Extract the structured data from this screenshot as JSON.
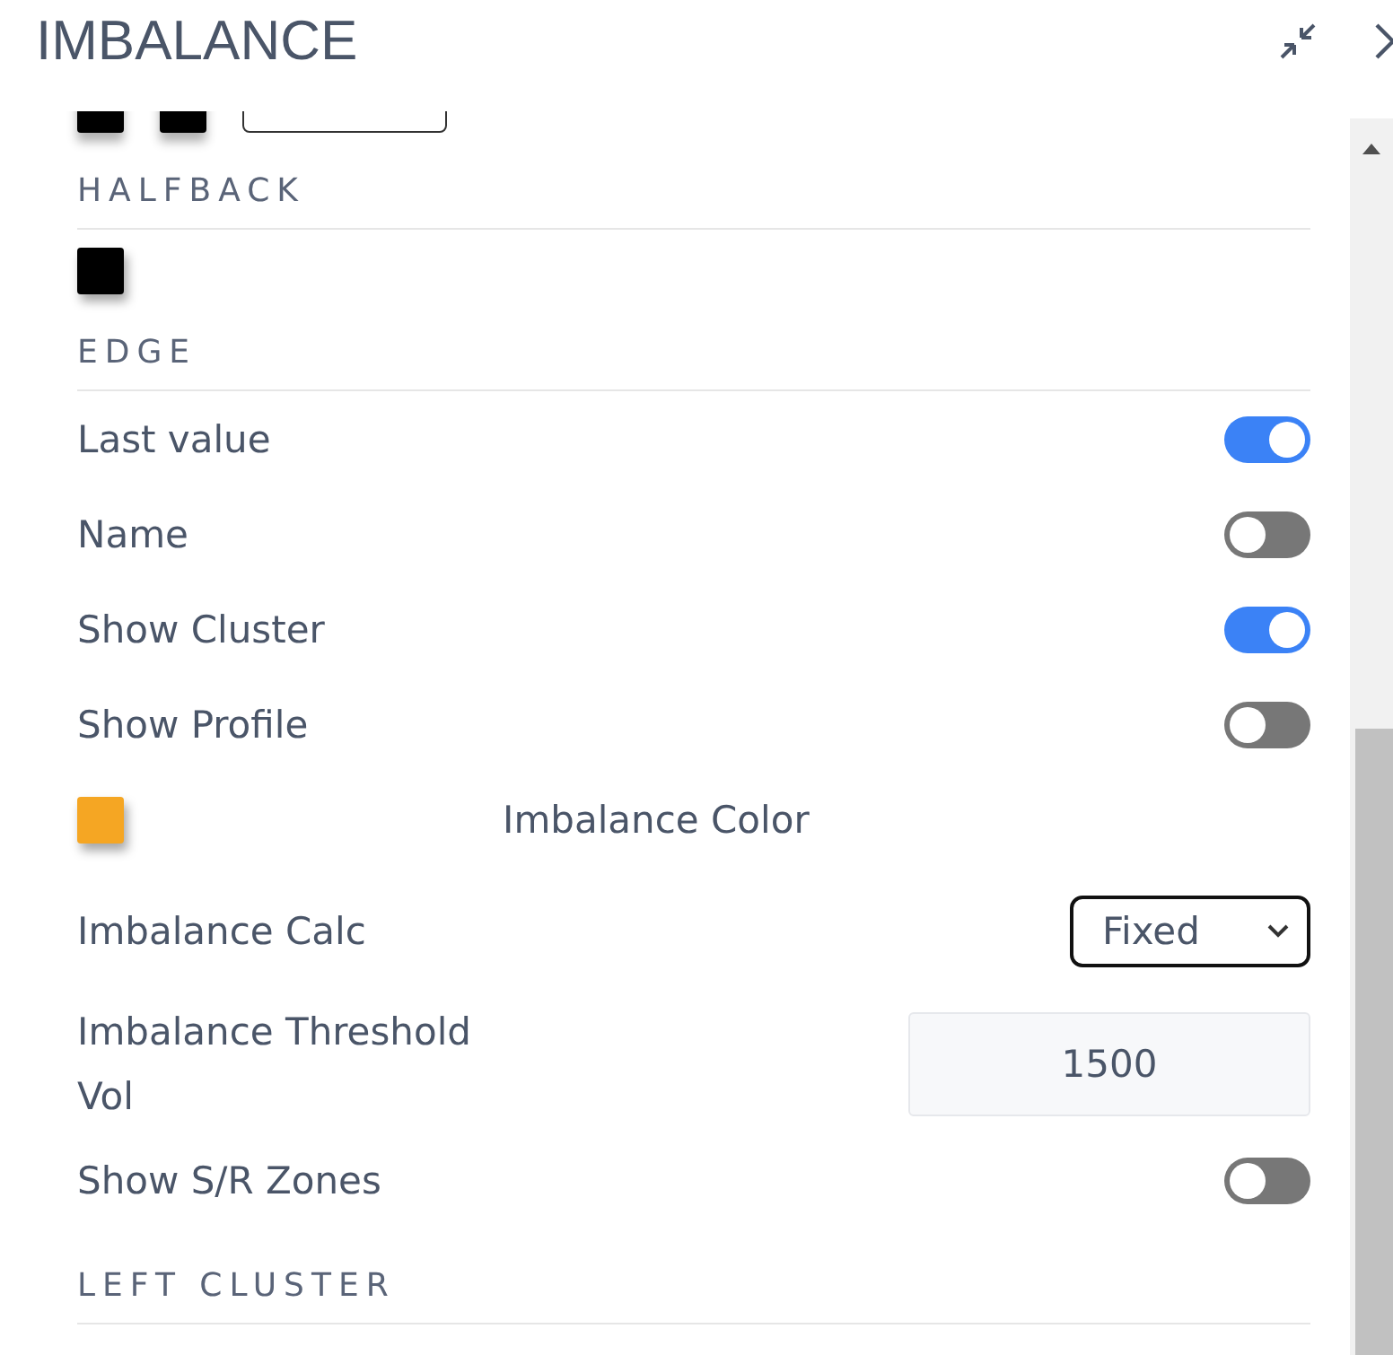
{
  "window": {
    "title": "IMBALANCE"
  },
  "top_swatches": [
    {
      "color": "#000000"
    },
    {
      "color": "#000000"
    }
  ],
  "rows": [
    {
      "kind": "section",
      "label": "HALFBACK"
    },
    {
      "kind": "swatch",
      "color": "#000000"
    },
    {
      "kind": "section",
      "label": "EDGE"
    },
    {
      "kind": "toggle",
      "label": "Last value",
      "on": true
    },
    {
      "kind": "toggle",
      "label": "Name",
      "on": false
    },
    {
      "kind": "toggle",
      "label": "Show Cluster",
      "on": true
    },
    {
      "kind": "toggle",
      "label": "Show Profile",
      "on": false
    },
    {
      "kind": "color",
      "label": "Imbalance Color",
      "color": "#f5a623"
    },
    {
      "kind": "select",
      "label": "Imbalance Calc",
      "value": "Fixed"
    },
    {
      "kind": "number",
      "label": "Imbalance Threshold Vol",
      "value": "1500"
    },
    {
      "kind": "toggle",
      "label": "Show S/R Zones",
      "on": false
    },
    {
      "kind": "section",
      "label": "LEFT CLUSTER"
    }
  ]
}
